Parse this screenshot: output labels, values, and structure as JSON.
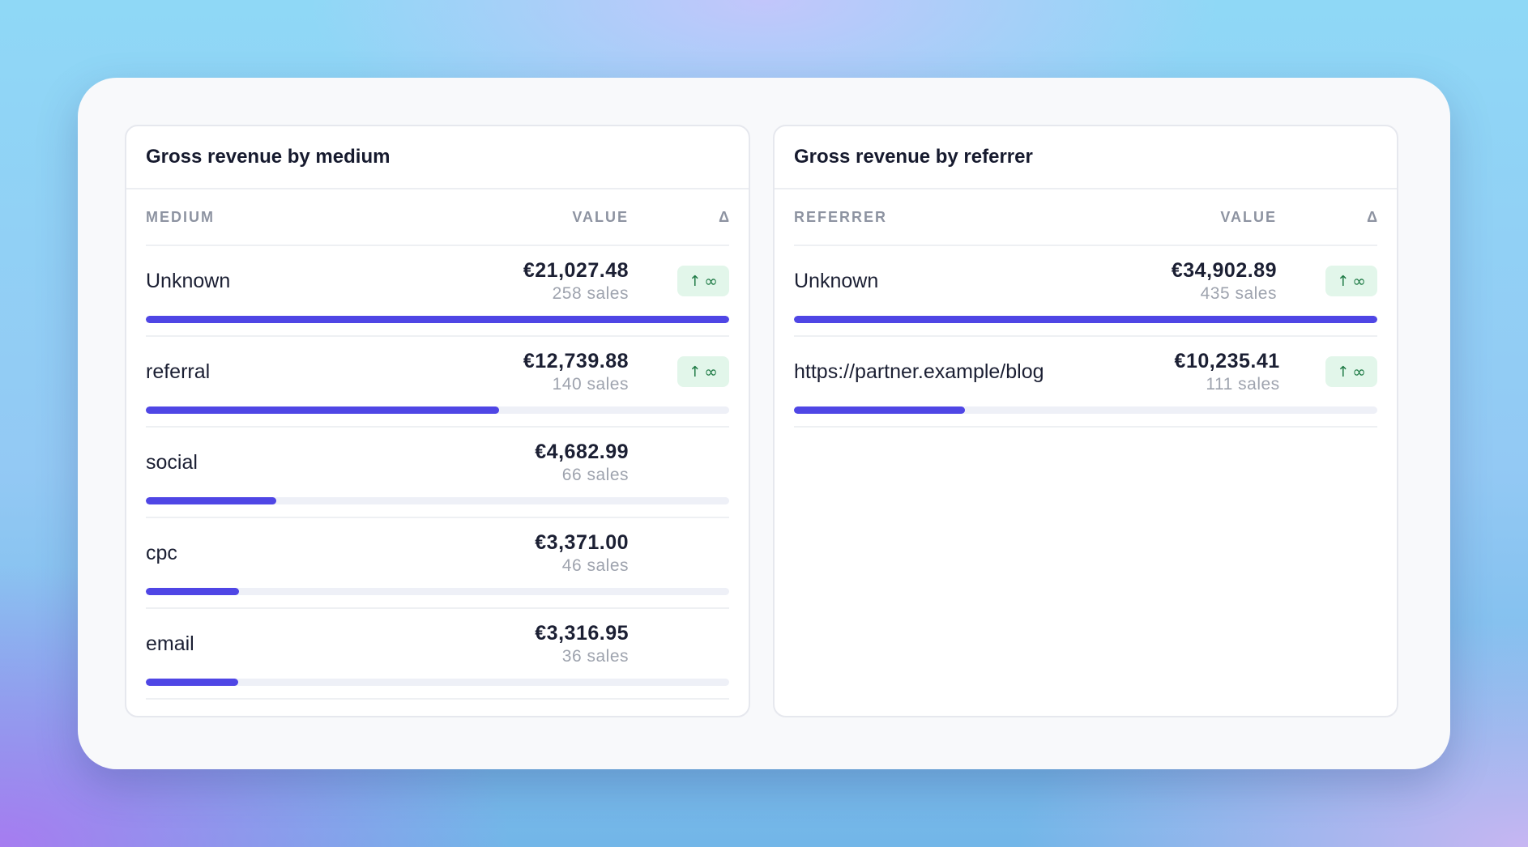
{
  "panels": [
    {
      "title": "Gross revenue by medium",
      "columns": {
        "name": "MEDIUM",
        "value": "VALUE",
        "delta": "Δ"
      },
      "rows": [
        {
          "name": "Unknown",
          "amount": "€21,027.48",
          "sales": "258 sales",
          "share": 1.0,
          "delta_arrow": "↑",
          "delta_value": "∞",
          "has_delta": true
        },
        {
          "name": "referral",
          "amount": "€12,739.88",
          "sales": "140 sales",
          "share": 0.606,
          "delta_arrow": "↑",
          "delta_value": "∞",
          "has_delta": true
        },
        {
          "name": "social",
          "amount": "€4,682.99",
          "sales": "66 sales",
          "share": 0.223,
          "has_delta": false
        },
        {
          "name": "cpc",
          "amount": "€3,371.00",
          "sales": "46 sales",
          "share": 0.16,
          "has_delta": false
        },
        {
          "name": "email",
          "amount": "€3,316.95",
          "sales": "36 sales",
          "share": 0.158,
          "has_delta": false
        }
      ]
    },
    {
      "title": "Gross revenue by referrer",
      "columns": {
        "name": "REFERRER",
        "value": "VALUE",
        "delta": "Δ"
      },
      "rows": [
        {
          "name": "Unknown",
          "amount": "€34,902.89",
          "sales": "435 sales",
          "share": 1.0,
          "delta_arrow": "↑",
          "delta_value": "∞",
          "has_delta": true
        },
        {
          "name": "https://partner.example/blog",
          "amount": "€10,235.41",
          "sales": "111 sales",
          "share": 0.293,
          "delta_arrow": "↑",
          "delta_value": "∞",
          "has_delta": true
        }
      ]
    }
  ],
  "colors": {
    "bar_fill": "#4f46e5",
    "bar_track": "#eef0f7",
    "badge_bg": "#e2f6ea",
    "badge_text": "#1e7a45"
  }
}
